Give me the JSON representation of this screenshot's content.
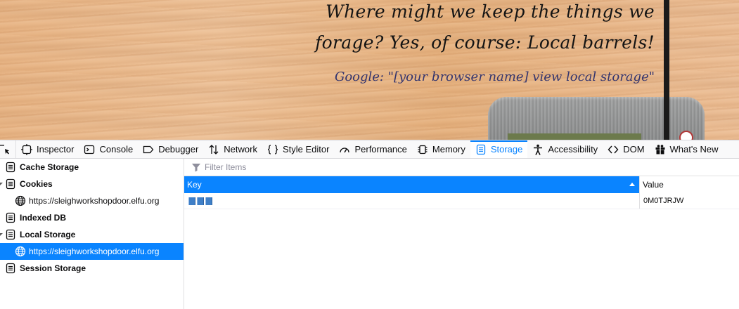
{
  "webpage": {
    "hint_line1": "Where might we keep the things we",
    "hint_line2": "forage? Yes, of course: Local barrels!",
    "hint_google": "Google: \"[your browser name] view local storage\""
  },
  "toolbar": {
    "tabs": [
      {
        "label": "Inspector",
        "icon": "inspector-icon"
      },
      {
        "label": "Console",
        "icon": "console-icon"
      },
      {
        "label": "Debugger",
        "icon": "debugger-icon"
      },
      {
        "label": "Network",
        "icon": "network-icon"
      },
      {
        "label": "Style Editor",
        "icon": "style-editor-icon"
      },
      {
        "label": "Performance",
        "icon": "performance-icon"
      },
      {
        "label": "Memory",
        "icon": "memory-icon"
      },
      {
        "label": "Storage",
        "icon": "storage-icon",
        "active": true
      },
      {
        "label": "Accessibility",
        "icon": "accessibility-icon"
      },
      {
        "label": "DOM",
        "icon": "dom-icon"
      },
      {
        "label": "What's New",
        "icon": "gift-icon"
      }
    ]
  },
  "sidebar": {
    "cache_storage": "Cache Storage",
    "cookies": "Cookies",
    "cookies_origin": "https://sleighworkshopdoor.elfu.org",
    "indexed_db": "Indexed DB",
    "local_storage": "Local Storage",
    "local_storage_origin": "https://sleighworkshopdoor.elfu.org",
    "session_storage": "Session Storage"
  },
  "filter": {
    "placeholder": "Filter Items"
  },
  "table": {
    "columns": {
      "key": "Key",
      "value": "Value"
    },
    "rows": [
      {
        "value": "0M0TJRJW"
      }
    ]
  },
  "colors": {
    "accent": "#0a84ff",
    "hint_google": "#34356e"
  }
}
